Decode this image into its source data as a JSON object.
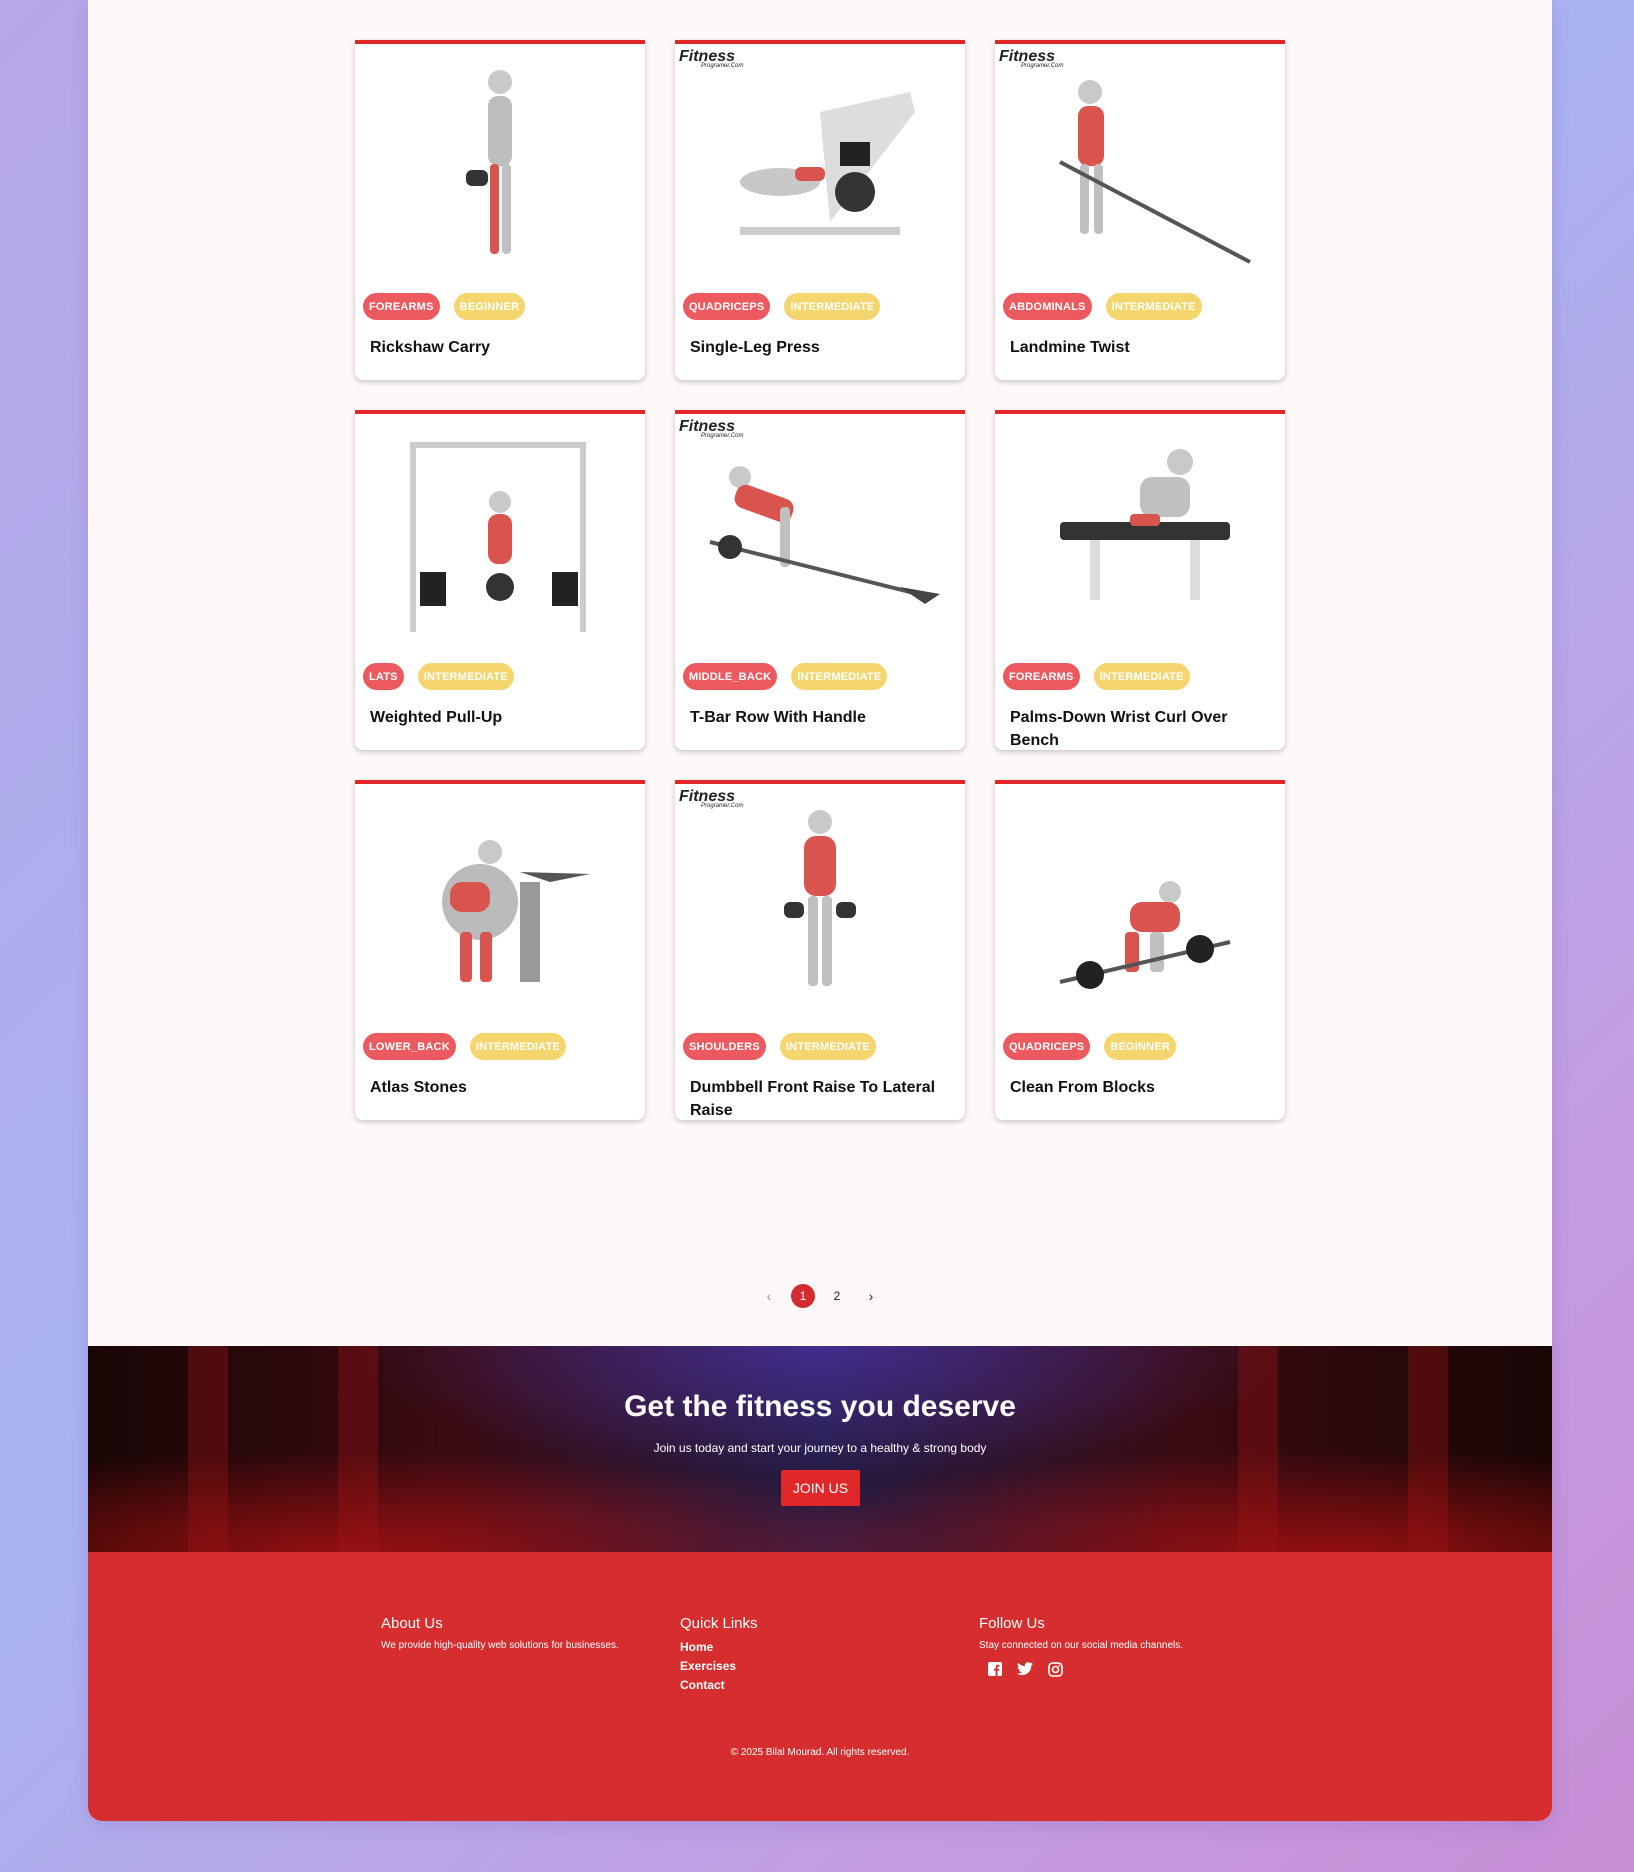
{
  "exercises": [
    {
      "name": "Rickshaw Carry",
      "muscle": "FOREARMS",
      "level": "BEGINNER",
      "watermark": false
    },
    {
      "name": "Single-Leg Press",
      "muscle": "QUADRICEPS",
      "level": "INTERMEDIATE",
      "watermark": true
    },
    {
      "name": "Landmine Twist",
      "muscle": "ABDOMINALS",
      "level": "INTERMEDIATE",
      "watermark": true
    },
    {
      "name": "Weighted Pull-Up",
      "muscle": "LATS",
      "level": "INTERMEDIATE",
      "watermark": false
    },
    {
      "name": "T-Bar Row With Handle",
      "muscle": "MIDDLE_BACK",
      "level": "INTERMEDIATE",
      "watermark": true
    },
    {
      "name": "Palms-Down Wrist Curl Over Bench",
      "muscle": "FOREARMS",
      "level": "INTERMEDIATE",
      "watermark": false
    },
    {
      "name": "Atlas Stones",
      "muscle": "LOWER_BACK",
      "level": "INTERMEDIATE",
      "watermark": false
    },
    {
      "name": "Dumbbell Front Raise To Lateral Raise",
      "muscle": "SHOULDERS",
      "level": "INTERMEDIATE",
      "watermark": true
    },
    {
      "name": "Clean From Blocks",
      "muscle": "QUADRICEPS",
      "level": "BEGINNER",
      "watermark": false
    }
  ],
  "watermark": {
    "brand": "Fitness",
    "sub": "Programer.Com"
  },
  "pagination": {
    "prev": "‹",
    "pages": [
      "1",
      "2"
    ],
    "current": "1",
    "next": "›"
  },
  "hero": {
    "title": "Get the fitness you deserve",
    "subtitle": "Join us today and start your journey to a healthy & strong body",
    "button": "JOIN US"
  },
  "footer": {
    "about": {
      "title": "About Us",
      "text": "We provide high-quality web solutions for businesses."
    },
    "links": {
      "title": "Quick Links",
      "items": [
        "Home",
        "Exercises",
        "Contact"
      ]
    },
    "follow": {
      "title": "Follow Us",
      "text": "Stay connected on our social media channels.",
      "icons": [
        "facebook-icon",
        "twitter-icon",
        "instagram-icon"
      ]
    },
    "copyright": "© 2025 Bilal Mourad. All rights reserved."
  },
  "colors": {
    "accent": "#d62e2f",
    "muscle_tag": "#ec5a5f",
    "level_tag": "#f5d66e"
  }
}
